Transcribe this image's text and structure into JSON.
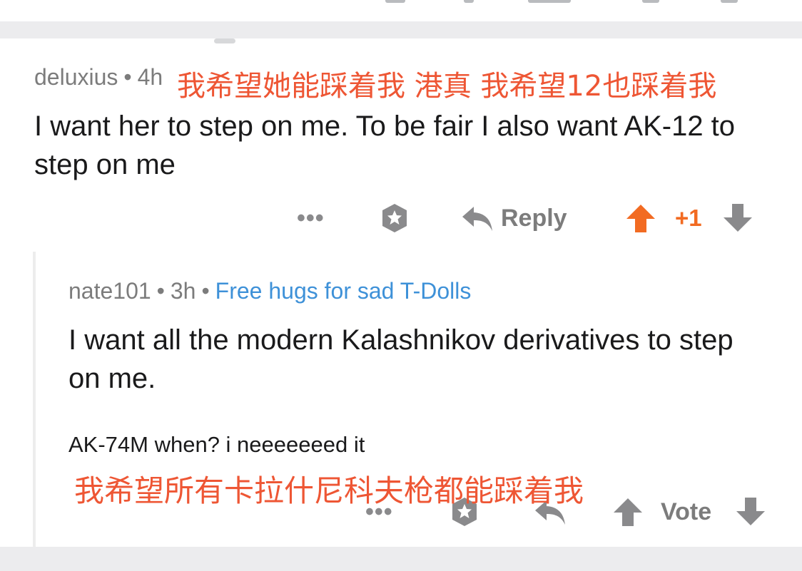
{
  "comment": {
    "author": "deluxius",
    "time": "4h",
    "text": "I want her to step on me. To be fair I also want AK-12 to step on me",
    "overlay_zh": "我希望她能踩着我 港真 我希望12也踩着我",
    "actions": {
      "more": "•••",
      "reply": "Reply",
      "score": "+1"
    }
  },
  "reply": {
    "author": "nate101",
    "time": "3h",
    "flair": "Free hugs for sad T-Dolls",
    "text": "I want all the modern Kalashnikov derivatives to step on me.",
    "subtext": "AK-74M when? i neeeeeeed it",
    "overlay_zh": "我希望所有卡拉什尼科夫枪都能踩着我",
    "actions": {
      "more": "•••",
      "vote": "Vote"
    }
  },
  "colors": {
    "upvote_active": "#f26b22",
    "icon_gray": "#8a8a8c",
    "flair": "#3e91d8",
    "overlay_text": "#ee5634"
  },
  "icons": [
    "more-icon",
    "award-icon",
    "reply-icon",
    "upvote-icon",
    "downvote-icon"
  ]
}
